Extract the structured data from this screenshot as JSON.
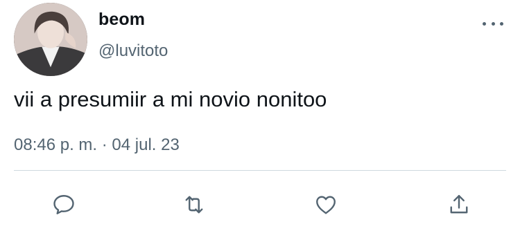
{
  "user": {
    "display_name": "beom",
    "handle": "@luvitoto",
    "avatar_icon": "profile-photo"
  },
  "tweet": {
    "text": "vii a presumiir a mi novio nonitoo",
    "timestamp": "08:46 p. m. · 04 jul. 23"
  },
  "actions": [
    {
      "name": "reply",
      "icon": "speech-bubble-icon"
    },
    {
      "name": "retweet",
      "icon": "retweet-arrows-icon"
    },
    {
      "name": "like",
      "icon": "heart-icon"
    },
    {
      "name": "share",
      "icon": "upload-arrow-icon"
    }
  ],
  "colors": {
    "text_primary": "#0f1419",
    "text_secondary": "#536471",
    "divider": "#cfd9de",
    "icon": "#536471"
  }
}
